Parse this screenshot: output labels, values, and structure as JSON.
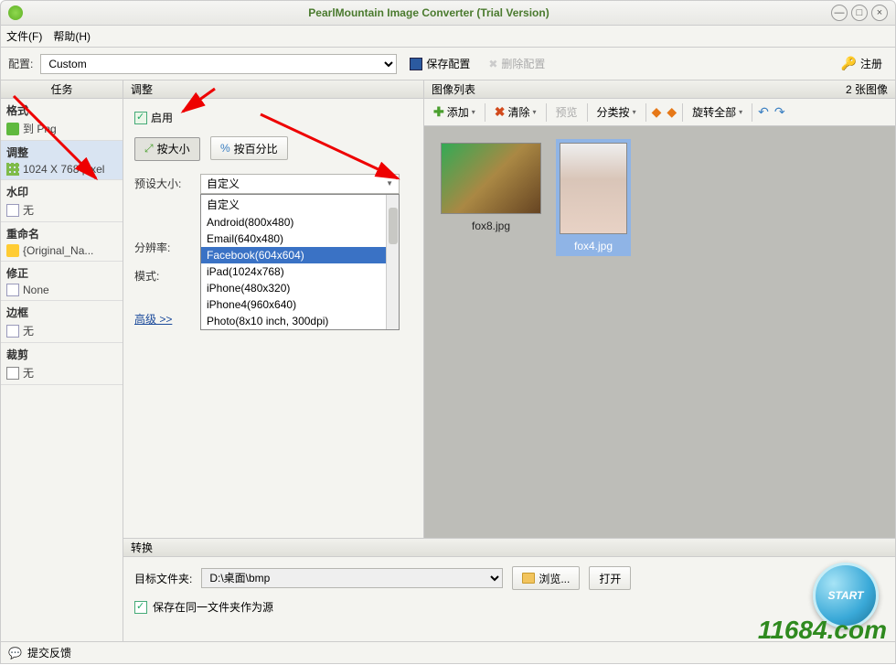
{
  "titlebar": {
    "title": "PearlMountain Image Converter (Trial Version)"
  },
  "menubar": {
    "file": "文件(F)",
    "help": "帮助(H)"
  },
  "toolbar": {
    "config_label": "配置:",
    "preset": "Custom",
    "save_config": "保存配置",
    "delete_config": "删除配置",
    "register": "注册"
  },
  "sidebar": {
    "header": "任务",
    "items": [
      {
        "cat": "格式",
        "val": "到 Png"
      },
      {
        "cat": "调整",
        "val": "1024 X 768 pixel"
      },
      {
        "cat": "水印",
        "val": "无"
      },
      {
        "cat": "重命名",
        "val": "{Original_Na..."
      },
      {
        "cat": "修正",
        "val": "None"
      },
      {
        "cat": "边框",
        "val": "无"
      },
      {
        "cat": "裁剪",
        "val": "无"
      }
    ]
  },
  "resize": {
    "header": "调整",
    "enable": "启用",
    "by_size": "按大小",
    "by_percent": "按百分比",
    "preset_label": "预设大小:",
    "preset_value": "自定义",
    "resolution_label": "分辨率:",
    "mode_label": "模式:",
    "advanced": "高级 >>",
    "options": [
      "自定义",
      "Android(800x480)",
      "Email(640x480)",
      "Facebook(604x604)",
      "iPad(1024x768)",
      "iPhone(480x320)",
      "iPhone4(960x640)",
      "Photo(8x10 inch, 300dpi)"
    ]
  },
  "imagelist": {
    "header": "图像列表",
    "count": "2 张图像",
    "add": "添加",
    "clear": "清除",
    "preview": "预览",
    "sort": "分类按",
    "rotate": "旋转全部",
    "thumbs": [
      {
        "name": "fox8.jpg",
        "selected": false
      },
      {
        "name": "fox4.jpg",
        "selected": true
      }
    ]
  },
  "convert": {
    "header": "转换",
    "target_label": "目标文件夹:",
    "target_path": "D:\\桌面\\bmp",
    "browse": "浏览...",
    "open": "打开",
    "same_folder": "保存在同一文件夹作为源",
    "start": "START"
  },
  "statusbar": {
    "feedback": "提交反馈"
  },
  "watermark": "11684.com"
}
